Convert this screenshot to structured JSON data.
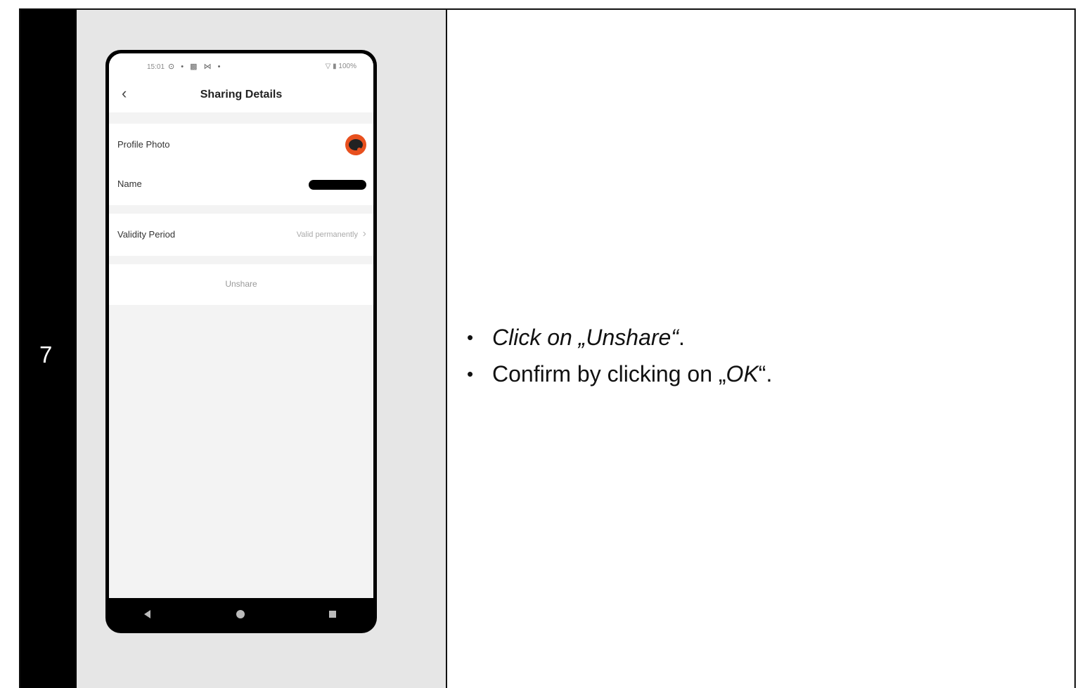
{
  "step": {
    "number": "7"
  },
  "instructions": {
    "item1": {
      "prefix": "Click on „Unshare“",
      "suffix": "."
    },
    "item2": {
      "prefix": "Confirm by clicking on „",
      "emph": "OK",
      "suffix": "“."
    }
  },
  "phone": {
    "status": {
      "time": "15:01",
      "battery": "100%",
      "icons_left": "⊙ • ▩ ⋈ •",
      "icons_right": "▽ ▮ 100%"
    },
    "header": {
      "back": "‹",
      "title": "Sharing Details"
    },
    "rows": {
      "profile_photo": "Profile Photo",
      "name": "Name",
      "validity_label": "Validity Period",
      "validity_value": "Valid permanently",
      "validity_chevron": "›"
    },
    "unshare": "Unshare"
  }
}
